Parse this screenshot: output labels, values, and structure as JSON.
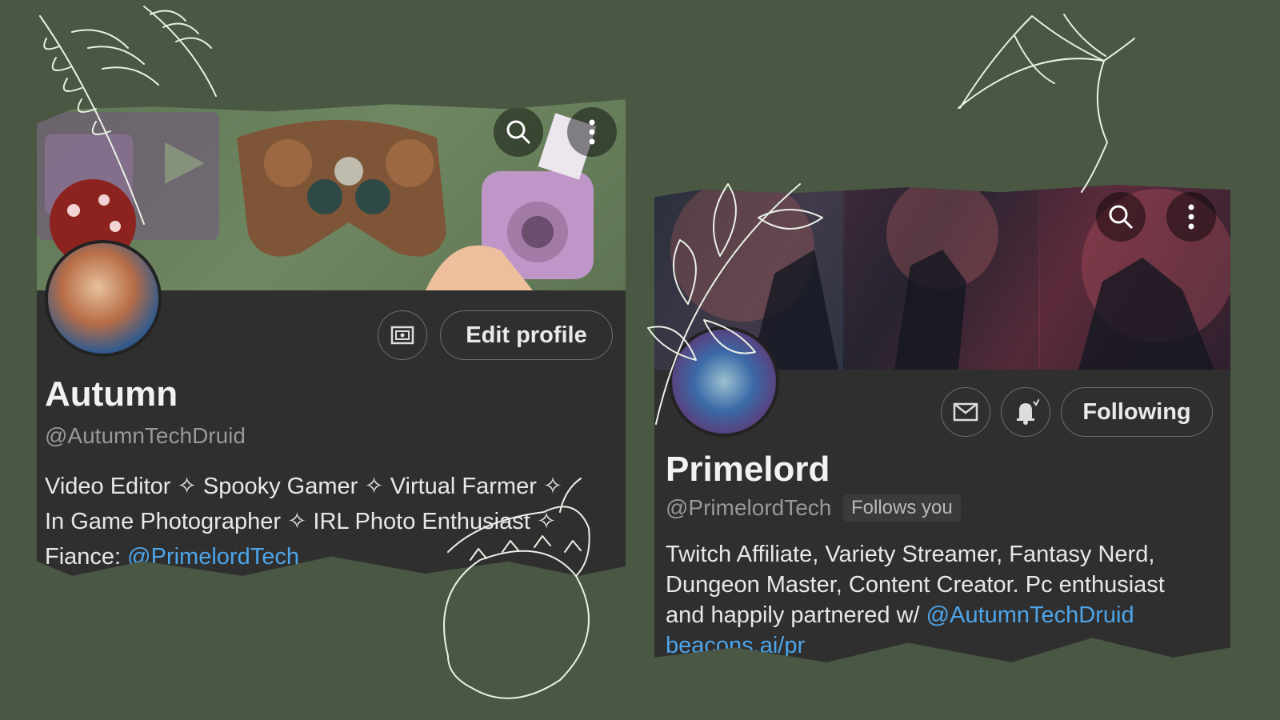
{
  "profile1": {
    "name": "Autumn",
    "handle": "@AutumnTechDruid",
    "edit_profile_label": "Edit profile",
    "bio_line1": "Video Editor  ✧  Spooky Gamer  ✧ Virtual Farmer ✧",
    "bio_line2": "In Game Photographer ✧ IRL Photo Enthusiast  ✧",
    "bio_line3_prefix": "Fiance: ",
    "bio_line3_link": "@PrimelordTech",
    "icons": {
      "search": "search-icon",
      "more": "more-vertical-icon",
      "media": "media-icon"
    }
  },
  "profile2": {
    "name": "Primelord",
    "handle": "@PrimelordTech",
    "follows_you_label": "Follows you",
    "following_label": "Following",
    "bio_line1": "Twitch Affiliate, Variety Streamer, Fantasy Nerd,",
    "bio_line2": "Dungeon Master, Content Creator. Pc enthusiast",
    "bio_line3_prefix": "and happily partnered w/ ",
    "bio_line3_link": "@AutumnTechDruid",
    "bio_line4_link": "beacons.ai/pr",
    "icons": {
      "search": "search-icon",
      "more": "more-vertical-icon",
      "message": "mail-icon",
      "notifications": "bell-icon"
    }
  },
  "colors": {
    "background": "#495743",
    "card": "#2f2f2f",
    "link": "#4da5ea",
    "muted": "#989898"
  }
}
